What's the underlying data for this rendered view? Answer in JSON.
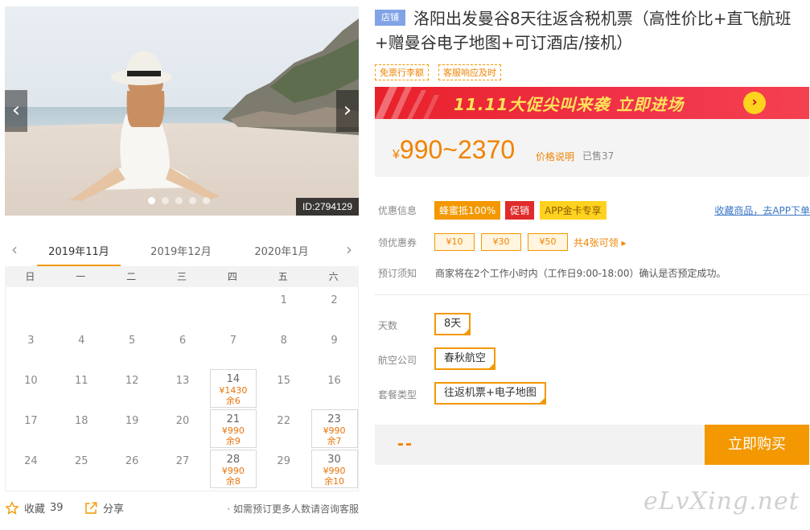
{
  "carousel": {
    "photo_id": "ID:2794129",
    "dot_count": 5,
    "active_dot": 0,
    "prev_icon": "chevron-left-icon",
    "next_icon": "chevron-right-icon"
  },
  "calendar": {
    "months": [
      "2019年11月",
      "2019年12月",
      "2020年1月"
    ],
    "active_month": 0,
    "weekdays": [
      "日",
      "一",
      "二",
      "三",
      "四",
      "五",
      "六"
    ],
    "first_weekday": 5,
    "days_in_month": 30,
    "available": {
      "14": {
        "price": "¥1430",
        "left": "余6"
      },
      "21": {
        "price": "¥990",
        "left": "余9"
      },
      "23": {
        "price": "¥990",
        "left": "余7"
      },
      "28": {
        "price": "¥990",
        "left": "余8"
      },
      "30": {
        "price": "¥990",
        "left": "余10"
      }
    }
  },
  "actions": {
    "favorite_label": "收藏",
    "favorite_count": "39",
    "share_label": "分享",
    "note": "· 如需预订更多人数请咨询客服"
  },
  "product": {
    "shop_badge": "店铺",
    "title": "洛阳出发曼谷8天往返含税机票（高性价比+直飞航班+赠曼谷电子地图+可订酒店/接机）",
    "tags": [
      "免票行李额",
      "客服响应及时"
    ]
  },
  "banner": {
    "text": "11.11大促尖叫来袭  立即进场",
    "arrow_icon": "circle-chevron-right-icon"
  },
  "pricing": {
    "currency": "¥",
    "range": "990~2370",
    "note": "价格说明",
    "sold": "已售37"
  },
  "discount": {
    "label": "优惠信息",
    "tags": [
      "蜂蜜抵100%",
      "促销",
      "APP金卡专享"
    ],
    "collect_link": "收藏商品，去APP下单"
  },
  "coupons": {
    "label": "领优惠券",
    "items": [
      "¥10",
      "¥30",
      "¥50"
    ],
    "more": "共4张可领 ▸"
  },
  "booking_notice": {
    "label": "预订须知",
    "text": "商家将在2个工作小时内（工作日9:00-18:00）确认是否预定成功。"
  },
  "options": {
    "days_label": "天数",
    "days_value": "8天",
    "airline_label": "航空公司",
    "airline_value": "春秋航空",
    "package_label": "套餐类型",
    "package_value": "往返机票+电子地图"
  },
  "buy": {
    "price_placeholder": "--",
    "button": "立即购买"
  },
  "watermark": "eLvXing.net",
  "colors": {
    "accent": "#f39800",
    "price": "#f08300",
    "banner": "#e8222a",
    "link": "#3a76c7",
    "shop_badge": "#82a4e6"
  }
}
